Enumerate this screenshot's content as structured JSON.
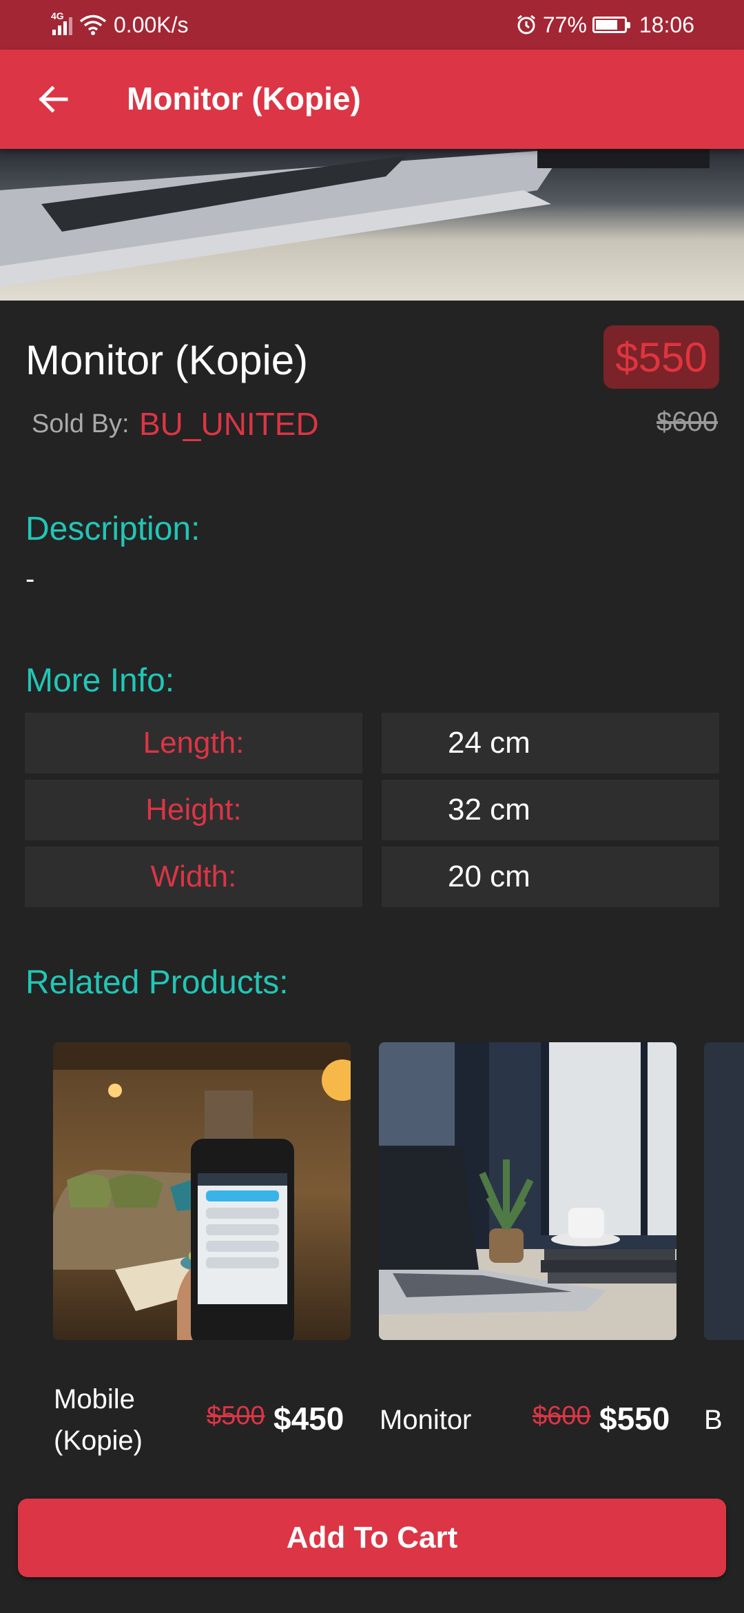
{
  "status_bar": {
    "network_type": "4G",
    "speed": "0.00K/s",
    "battery": "77%",
    "time": "18:06"
  },
  "app_bar": {
    "title": "Monitor (Kopie)",
    "back_icon": "arrow-left-icon"
  },
  "product": {
    "name": "Monitor (Kopie)",
    "price": "$550",
    "old_price": "$600",
    "sold_by_label": "Sold By:",
    "seller": "BU_UNITED"
  },
  "description": {
    "heading": "Description:",
    "text": "-"
  },
  "more_info": {
    "heading": "More Info:",
    "rows": [
      {
        "key": "Length:",
        "value": "24 cm"
      },
      {
        "key": "Height:",
        "value": "32 cm"
      },
      {
        "key": "Width:",
        "value": "20 cm"
      }
    ]
  },
  "related": {
    "heading": "Related Products:",
    "items": [
      {
        "name": "Mobile (Kopie)",
        "old_price": "$500",
        "price": "$450"
      },
      {
        "name": "Monitor",
        "old_price": "$600",
        "price": "$550"
      },
      {
        "name": "B"
      }
    ]
  },
  "actions": {
    "add_to_cart": "Add To Cart"
  },
  "colors": {
    "primary": "#dc3545",
    "status_bar": "#a32634",
    "accent": "#21c6b6",
    "background": "#232323",
    "cell": "#2e2e2e"
  }
}
